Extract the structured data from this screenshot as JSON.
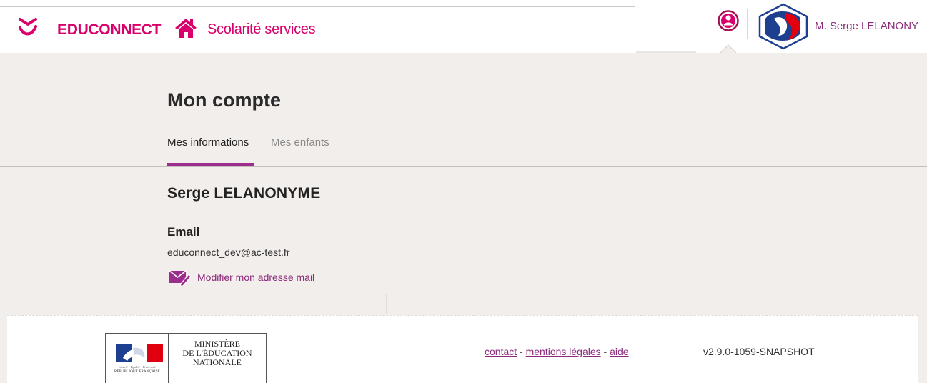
{
  "header": {
    "brand": "EDUCONNECT",
    "service": "Scolarité services",
    "user_name": "M. Serge LELANONY"
  },
  "icons": {
    "logo": "educonnect-logo-icon",
    "home": "home-icon",
    "user": "user-circle-icon",
    "academie": "academie-logo-icon",
    "mail": "mail-edit-icon"
  },
  "page": {
    "title": "Mon compte",
    "tabs": [
      {
        "label": "Mes informations",
        "active": true
      },
      {
        "label": "Mes enfants",
        "active": false
      }
    ]
  },
  "profile": {
    "name": "Serge LELANONYME",
    "email_label": "Email",
    "email_value": "educonnect_dev@ac-test.fr",
    "modify_email_label": "Modifier mon adresse mail"
  },
  "footer": {
    "ministry_lines": [
      "MINISTÈRE",
      "DE L'ÉDUCATION",
      "NATIONALE"
    ],
    "motto": "Liberté • Égalité • Fraternité",
    "republique": "RÉPUBLIQUE FRANÇAISE",
    "links": [
      "contact",
      "mentions légales",
      "aide"
    ],
    "link_separator": " - ",
    "version": "v2.9.0-1059-SNAPSHOT"
  },
  "colors": {
    "brand_pink": "#d9006c",
    "accent_purple": "#9c2d8d",
    "link_purple": "#8c2a7a",
    "background": "#f2eeec"
  }
}
